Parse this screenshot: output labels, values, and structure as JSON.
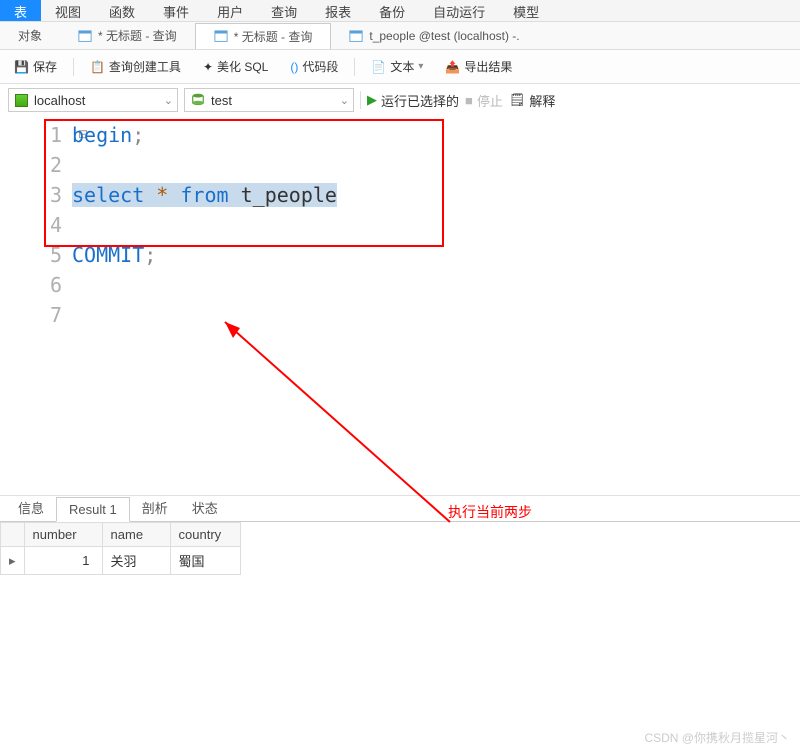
{
  "menu": {
    "items": [
      "表",
      "视图",
      "函数",
      "事件",
      "用户",
      "查询",
      "报表",
      "备份",
      "自动运行",
      "模型"
    ],
    "active_index": 0
  },
  "tabs": {
    "list": [
      {
        "label": "对象",
        "dirty": false,
        "icon": ""
      },
      {
        "label": "无标题 - 查询",
        "dirty": true,
        "icon": "table"
      },
      {
        "label": "无标题 - 查询",
        "dirty": true,
        "icon": "table",
        "active": true
      },
      {
        "label": "t_people @test (localhost) -.",
        "dirty": false,
        "icon": "table"
      }
    ]
  },
  "toolbar": {
    "save": "保存",
    "query_builder": "查询创建工具",
    "beautify": "美化 SQL",
    "snippet": "代码段",
    "text": "文本",
    "export": "导出结果"
  },
  "conn": {
    "host": "localhost",
    "db": "test",
    "run": "运行已选择的",
    "stop": "停止",
    "explain": "解释"
  },
  "sql": {
    "lines": [
      {
        "n": 1,
        "tokens": [
          [
            "kw",
            "begin"
          ],
          [
            "sym",
            ";"
          ]
        ]
      },
      {
        "n": 2,
        "tokens": []
      },
      {
        "n": 3,
        "tokens": [
          [
            "kw",
            "select"
          ],
          [
            "plain",
            " "
          ],
          [
            "star",
            "*"
          ],
          [
            "plain",
            " "
          ],
          [
            "kw",
            "from"
          ],
          [
            "plain",
            " "
          ],
          [
            "ident",
            "t_people"
          ]
        ],
        "selected": true
      },
      {
        "n": 4,
        "tokens": []
      },
      {
        "n": 5,
        "tokens": [
          [
            "kw",
            "COMMIT"
          ],
          [
            "sym",
            ";"
          ]
        ]
      },
      {
        "n": 6,
        "tokens": []
      },
      {
        "n": 7,
        "tokens": []
      }
    ]
  },
  "annotation": "执行当前两步",
  "result": {
    "tabs": [
      "信息",
      "Result 1",
      "剖析",
      "状态"
    ],
    "active_tab": 1,
    "columns": [
      "number",
      "name",
      "country"
    ],
    "rows": [
      {
        "number": 1,
        "name": "关羽",
        "country": "蜀国"
      }
    ]
  },
  "watermark": "CSDN @你携秋月揽星河丶"
}
